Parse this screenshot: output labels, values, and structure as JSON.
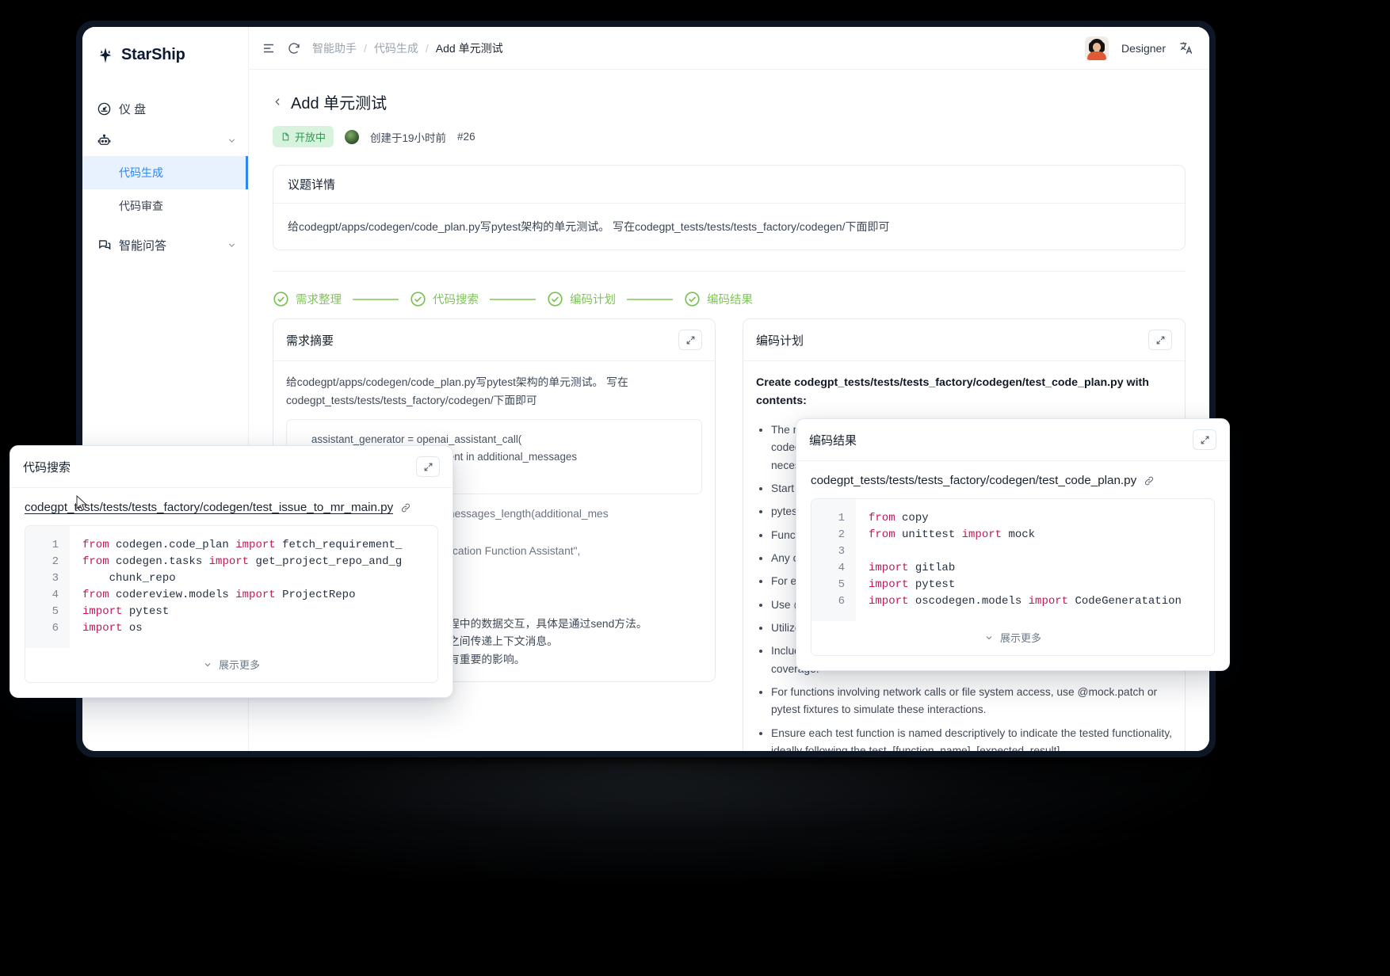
{
  "brand": {
    "name": "StarShip",
    "logo_icon": "starship-logo-icon"
  },
  "sidebar": {
    "items": [
      {
        "label": "仪  盘",
        "icon": "dashboard-icon"
      },
      {
        "label": "",
        "icon": "robot-icon",
        "chevron": "chevron-down-icon"
      },
      {
        "label": "智能问答",
        "icon": "chat-bubbles-icon",
        "chevron": "chevron-down-icon"
      }
    ],
    "sub_items": [
      {
        "label": "代码生成",
        "active": true
      },
      {
        "label": "代码审查",
        "active": false
      }
    ],
    "active_color": "#2f86f0",
    "active_bg": "#e8f2fe"
  },
  "topbar": {
    "menu_icon": "menu-collapse-icon",
    "refresh_icon": "refresh-icon",
    "breadcrumbs": [
      {
        "label": "智能助手",
        "current": false
      },
      {
        "label": "代码生成",
        "current": false
      },
      {
        "label": "Add 单元测试",
        "current": true
      }
    ],
    "separator": "/",
    "user_name": "Designer",
    "avatar_icon": "user-avatar",
    "language_icon": "translate-icon"
  },
  "page": {
    "back_icon": "chevron-left-icon",
    "title": "Add 单元测试",
    "status_badge": {
      "label": "开放中",
      "icon": "open-issue-icon",
      "color": "#2f9a4f",
      "bg": "#d7f3dd"
    },
    "author_avatar": "author-avatar",
    "created_text": "创建于19小时前",
    "issue_id": "#26"
  },
  "issue_detail": {
    "title": "议题详情",
    "body": "给codegpt/apps/codegen/code_plan.py写pytest架构的单元测试。 写在codegpt_tests/tests/tests_factory/codegen/下面即可"
  },
  "steps": {
    "check_icon": "check-circle-icon",
    "color": "#7ec457",
    "items": [
      {
        "label": "需求整理",
        "done": true
      },
      {
        "label": "代码搜索",
        "done": true
      },
      {
        "label": "编码计划",
        "done": true
      },
      {
        "label": "编码结果",
        "done": true
      }
    ]
  },
  "requirement_summary": {
    "title": "需求摘要",
    "expand_icon": "expand-icon",
    "text": "给codegpt/apps/codegen/code_plan.py写pytest架构的单元测试。 写在codegpt_tests/tests/tests_factory/codegen/下面即可",
    "code_block": "    assistant_generator = openai_assistant_call(\n        request=\"\",  # already present in additional_messages\n        instructions=instructions,",
    "code_block_tail_1": "nal_messages_length(additional_mes",
    "code_block_tail_2": "cation Function Assistant\",",
    "tail_text_lines": [
      "程中的数据交互，具体是通过send方法。",
      "之间传递上下文消息。",
      "有重要的影响。"
    ]
  },
  "code_search": {
    "title": "代码搜索",
    "expand_icon": "expand-icon",
    "file_path": "codegpt_tests/tests/tests_factory/codegen/test_issue_to_mr_main.py",
    "link_icon": "link-icon",
    "line_numbers": [
      "1",
      "2",
      "3",
      "4",
      "5",
      "6"
    ],
    "code_lines": [
      [
        {
          "t": "from",
          "k": true
        },
        {
          "t": " codegen.code_plan ",
          "k": false
        },
        {
          "t": "import",
          "k": true
        },
        {
          "t": " fetch_requirement_",
          "k": false
        }
      ],
      [
        {
          "t": "from",
          "k": true
        },
        {
          "t": " codegen.tasks ",
          "k": false
        },
        {
          "t": "import",
          "k": true
        },
        {
          "t": " get_project_repo_and_g",
          "k": false
        }
      ],
      [
        {
          "t": "    chunk_repo",
          "k": false
        }
      ],
      [
        {
          "t": "from",
          "k": true
        },
        {
          "t": " codereview.models ",
          "k": false
        },
        {
          "t": "import",
          "k": true
        },
        {
          "t": " ProjectRepo",
          "k": false
        }
      ],
      [
        {
          "t": "import",
          "k": true
        },
        {
          "t": " pytest",
          "k": false
        }
      ],
      [
        {
          "t": "import",
          "k": true
        },
        {
          "t": " os",
          "k": false
        }
      ]
    ],
    "show_more": "展示更多",
    "show_more_icon": "chevron-down-icon"
  },
  "coding_plan": {
    "title": "编码计划",
    "expand_icon": "expand-icon",
    "intro": "Create codegpt_tests/tests/tests_factory/codegen/test_code_plan.py with contents:",
    "bullets": [
      "The new file, test_code_plan.py, will be created under codegpt_tests/tests/tests_factory/codegen/ directory. It aims to contain all necessary unit tests for code_plan.p",
      "Start by imp",
      "pytest from",
      "Functions ar testing.",
      "Any other re mocking, da other test fi",
      "For each fur correspondi",
      "Use @pytes tests run wi",
      "Utilize mock tests to isol",
      "Include both (handling of incorrect inputs or exceptions) to ensure comprehensive coverage.",
      "For functions involving network calls or file system access, use @mock.patch or pytest fixtures to simulate these interactions.",
      "Ensure each test function is named descriptively to indicate the tested functionality, ideally following the test_[function_name]_[expected_result]"
    ]
  },
  "coding_result": {
    "title": "编码结果",
    "expand_icon": "expand-icon",
    "file_path": "codegpt_tests/tests/tests_factory/codegen/test_code_plan.py",
    "link_icon": "link-icon",
    "line_numbers": [
      "1",
      "2",
      "3",
      "4",
      "5",
      "6"
    ],
    "code_lines": [
      [
        {
          "t": "from",
          "k": true
        },
        {
          "t": " copy",
          "k": false
        }
      ],
      [
        {
          "t": "from",
          "k": true
        },
        {
          "t": " unittest ",
          "k": false
        },
        {
          "t": "import",
          "k": true
        },
        {
          "t": " mock",
          "k": false
        }
      ],
      [
        {
          "t": "",
          "k": false
        }
      ],
      [
        {
          "t": "import",
          "k": true
        },
        {
          "t": " gitlab",
          "k": false
        }
      ],
      [
        {
          "t": "import",
          "k": true
        },
        {
          "t": " pytest",
          "k": false
        }
      ],
      [
        {
          "t": "import",
          "k": true
        },
        {
          "t": " oscodegen.models ",
          "k": false
        },
        {
          "t": "import",
          "k": true
        },
        {
          "t": " CodeGeneratation",
          "k": false
        }
      ]
    ],
    "show_more": "展示更多",
    "show_more_icon": "chevron-down-icon"
  }
}
